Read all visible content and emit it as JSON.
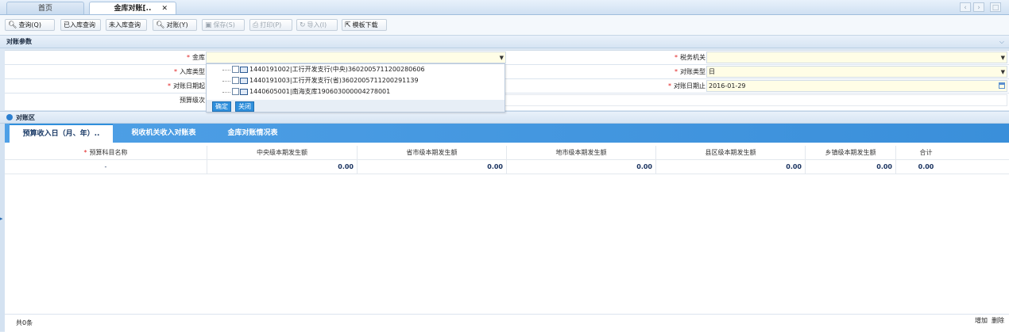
{
  "tabs": {
    "home": "首页",
    "reconcile": "金库对账[..",
    "close": "✕"
  },
  "toolbar": {
    "query": "查询(Q)",
    "stored_query": "已入库查询",
    "unstored_query": "未入库查询",
    "reconcile": "对账(Y)",
    "save": "保存(S)",
    "print": "打印(P)",
    "import": "导入(I)",
    "template": "模板下载"
  },
  "params": {
    "title": "对账参数",
    "treasury_label": "金库",
    "treasury_value": "",
    "tax_office_label": "税务机关",
    "tax_office_value": "",
    "entry_type_label": "入库类型",
    "recon_type_label": "对账类型",
    "recon_type_value": "日",
    "date_start_label": "对账日期起",
    "date_end_label": "对账日期止",
    "date_end_value": "2016-01-29",
    "budget_level_label": "预算级次"
  },
  "dropdown": {
    "options": [
      "1440191002|工行开发支行(中央)3602005711200280606",
      "1440191003|工行开发支行(省)3602005711200291139",
      "1440605001|南海支库190603000004278001"
    ],
    "confirm": "确定",
    "close": "关闭"
  },
  "area": {
    "title": "对账区",
    "tabs": [
      "预算收入日（月、年）..",
      "税收机关收入对账表",
      "金库对账情况表"
    ],
    "columns": [
      "预算科目名称",
      "中央级本期发生额",
      "省市级本期发生额",
      "地市级本期发生额",
      "县区级本期发生额",
      "乡镇级本期发生额",
      "合计"
    ],
    "row": {
      "name": "-",
      "values": [
        "0.00",
        "0.00",
        "0.00",
        "0.00",
        "0.00",
        "0.00"
      ]
    }
  },
  "footer": {
    "total": "共0条",
    "add": "增加",
    "delete": "删除"
  },
  "colors": {
    "accent": "#3a8fda",
    "required": "#e02020",
    "field_bg": "#fffde6"
  }
}
